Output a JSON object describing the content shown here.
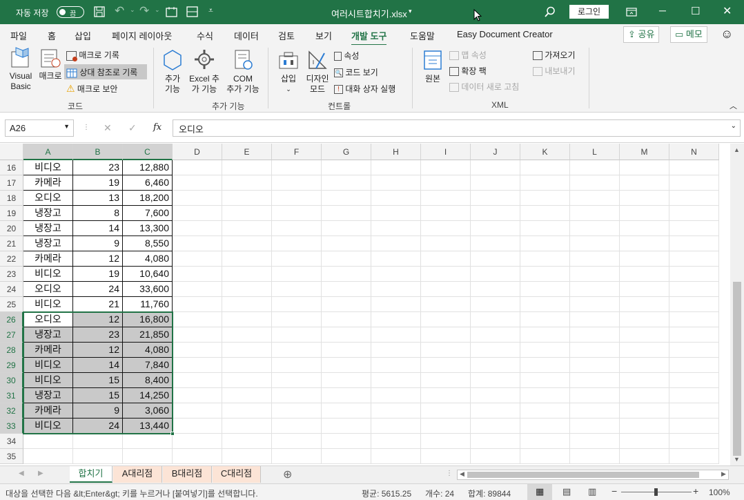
{
  "titlebar": {
    "autosave_label": "자동 저장",
    "autosave_state": "끔",
    "filename": "여러시트합치기.xlsx",
    "login_label": "로그인"
  },
  "tabs": [
    "파일",
    "홈",
    "삽입",
    "페이지 레이아웃",
    "수식",
    "데이터",
    "검토",
    "보기",
    "개발 도구",
    "도움말",
    "Easy Document Creator"
  ],
  "active_tab": "개발 도구",
  "share_label": "공유",
  "memo_label": "메모",
  "ribbon": {
    "visual_basic": [
      "Visual",
      "Basic"
    ],
    "macro": "매크로",
    "record_macro": "매크로 기록",
    "relative_ref": "상대 참조로 기록",
    "macro_security": "매크로 보안",
    "group_code": "코드",
    "addins": [
      "추가",
      "기능"
    ],
    "excel_addins": [
      "Excel 추",
      "가 기능"
    ],
    "com_addins": [
      "COM",
      "추가 기능"
    ],
    "group_addins": "추가 기능",
    "insert": "삽입",
    "design_mode": [
      "디자인",
      "모드"
    ],
    "properties": "속성",
    "view_code": "코드 보기",
    "run_dialog": "대화 상자 실행",
    "group_controls": "컨트롤",
    "source": "원본",
    "map_properties": "맵 속성",
    "expansion_packs": "확장 팩",
    "refresh_data": "데이터 새로 고침",
    "import": "가져오기",
    "export": "내보내기",
    "group_xml": "XML"
  },
  "formula": {
    "name_box": "A26",
    "fx": "fx",
    "value": "오디오"
  },
  "columns": [
    "A",
    "B",
    "C",
    "D",
    "E",
    "F",
    "G",
    "H",
    "I",
    "J",
    "K",
    "L",
    "M",
    "N"
  ],
  "rows": [
    {
      "n": "16",
      "a": "비디오",
      "b": "23",
      "c": "12,880"
    },
    {
      "n": "17",
      "a": "카메라",
      "b": "19",
      "c": "6,460"
    },
    {
      "n": "18",
      "a": "오디오",
      "b": "13",
      "c": "18,200"
    },
    {
      "n": "19",
      "a": "냉장고",
      "b": "8",
      "c": "7,600"
    },
    {
      "n": "20",
      "a": "냉장고",
      "b": "14",
      "c": "13,300"
    },
    {
      "n": "21",
      "a": "냉장고",
      "b": "9",
      "c": "8,550"
    },
    {
      "n": "22",
      "a": "카메라",
      "b": "12",
      "c": "4,080"
    },
    {
      "n": "23",
      "a": "비디오",
      "b": "19",
      "c": "10,640"
    },
    {
      "n": "24",
      "a": "오디오",
      "b": "24",
      "c": "33,600"
    },
    {
      "n": "25",
      "a": "비디오",
      "b": "21",
      "c": "11,760"
    },
    {
      "n": "26",
      "a": "오디오",
      "b": "12",
      "c": "16,800"
    },
    {
      "n": "27",
      "a": "냉장고",
      "b": "23",
      "c": "21,850"
    },
    {
      "n": "28",
      "a": "카메라",
      "b": "12",
      "c": "4,080"
    },
    {
      "n": "29",
      "a": "비디오",
      "b": "14",
      "c": "7,840"
    },
    {
      "n": "30",
      "a": "비디오",
      "b": "15",
      "c": "8,400"
    },
    {
      "n": "31",
      "a": "냉장고",
      "b": "15",
      "c": "14,250"
    },
    {
      "n": "32",
      "a": "카메라",
      "b": "9",
      "c": "3,060"
    },
    {
      "n": "33",
      "a": "비디오",
      "b": "24",
      "c": "13,440"
    },
    {
      "n": "34",
      "a": "",
      "b": "",
      "c": ""
    },
    {
      "n": "35",
      "a": "",
      "b": "",
      "c": ""
    }
  ],
  "sheets": [
    "합치기",
    "A대리점",
    "B대리점",
    "C대리점"
  ],
  "active_sheet": "합치기",
  "status": {
    "message": "대상을 선택한 다음 &lt;Enter&gt; 키를 누르거나 [붙여넣기]를 선택합니다.",
    "average": "평균: 5615.25",
    "count": "개수: 24",
    "sum": "합계: 89844",
    "zoom": "100%"
  },
  "colors": {
    "accent": "#217346",
    "sheet_tab_orange": "#fce4d6",
    "selection_fill": "#c9c9c9"
  }
}
